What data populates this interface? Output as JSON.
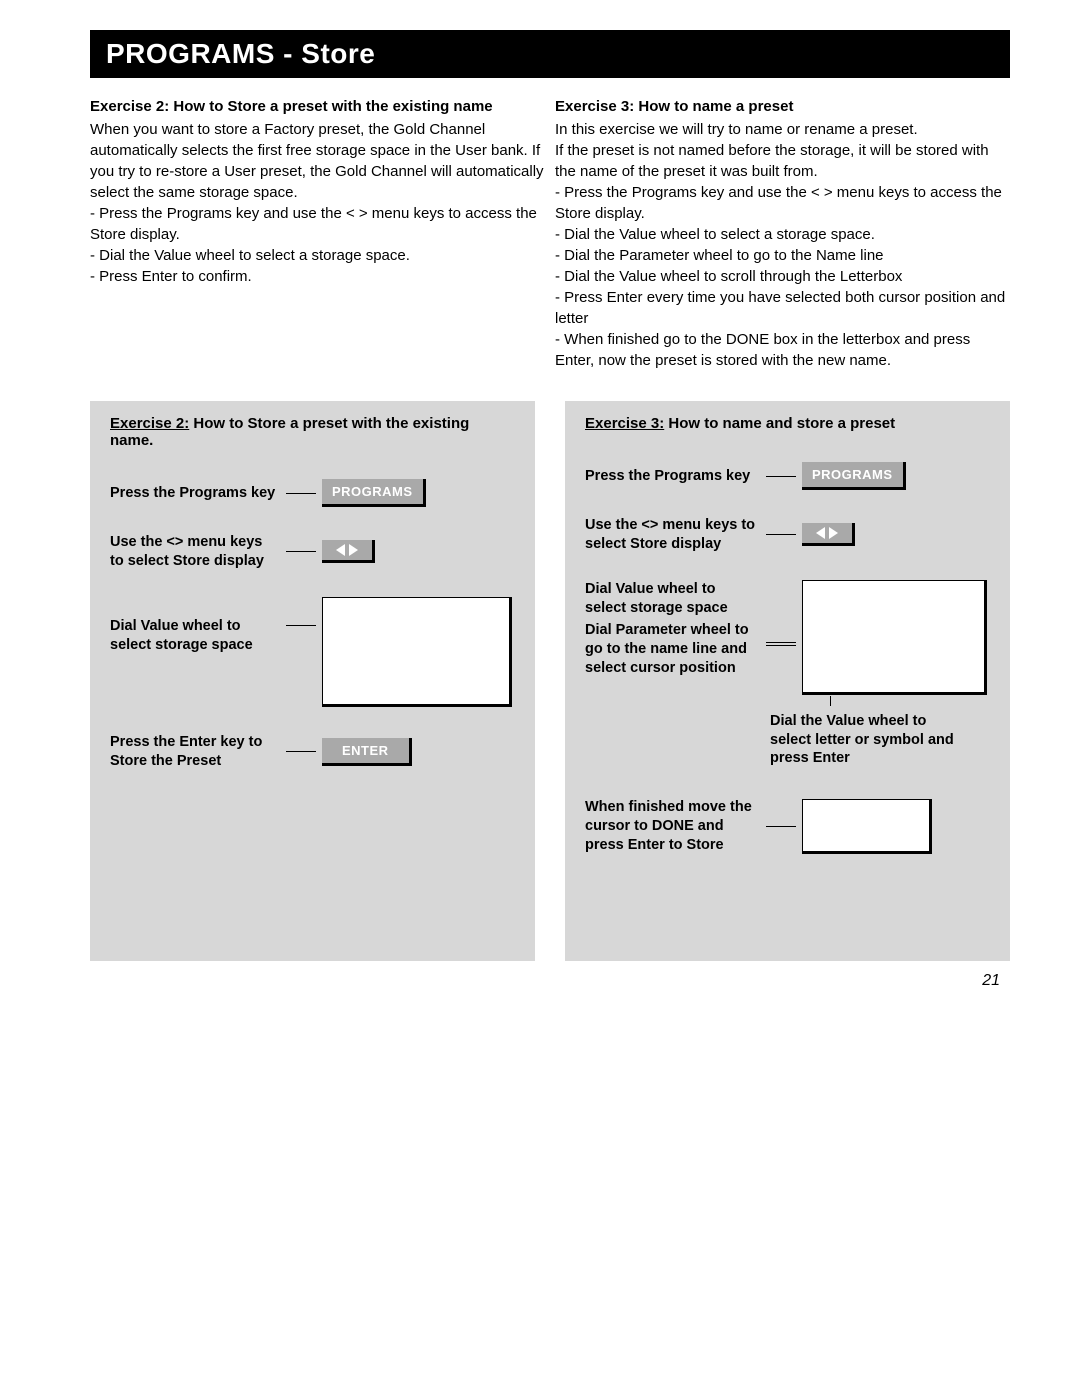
{
  "title_bar": "PROGRAMS - Store",
  "page_number": "21",
  "left_intro": {
    "heading": "Exercise 2: How to Store a preset with the existing name",
    "p1": "When you want to store a Factory preset, the Gold Channel automatically selects the first free storage space in the User bank. If you try to re-store a User preset, the Gold Channel will automatically select the same storage space.",
    "b1": "- Press the Programs key and use the < > menu keys to access the Store display.",
    "b2": "- Dial the Value wheel to select a storage space.",
    "b3": "- Press Enter to confirm."
  },
  "right_intro": {
    "heading": "Exercise 3: How to name a preset",
    "p1": "In this exercise we will try to name or rename a preset.",
    "p2": "If the preset is not named before the storage, it will be stored with the name of the preset it was built from.",
    "b1": "- Press the Programs key and use the < > menu keys to access the Store display.",
    "b2": "- Dial the Value wheel to select a storage space.",
    "b3": "- Dial the Parameter wheel to go to the Name line",
    "b4": "- Dial the Value wheel to scroll through the Letterbox",
    "b5": "- Press Enter every time you have selected both cursor position and letter",
    "b6": "- When finished go to the DONE box in the letterbox and press Enter, now the preset is stored with the new name."
  },
  "diag_left": {
    "title_u": "Exercise 2:",
    "title_rest": " How to Store a preset with the existing name.",
    "s1": "Press the Programs key",
    "s2": "Use the <> menu keys to select Store display",
    "s3": "Dial Value wheel to select storage space",
    "s4": "Press the Enter key to Store the Preset",
    "btn_programs": "PROGRAMS",
    "btn_enter": "ENTER"
  },
  "diag_right": {
    "title_u": "Exercise 3:",
    "title_rest": " How to name and store a preset",
    "s1": "Press the Programs key",
    "s2": "Use the <> menu keys to select Store display",
    "s3a": "Dial Value wheel to select storage space",
    "s3b": "Dial Parameter wheel to go to the name line and select cursor position",
    "s3c": "Dial the Value wheel to select letter or symbol and press Enter",
    "s4": "When finished move the cursor to DONE and press Enter to Store",
    "btn_programs": "PROGRAMS"
  }
}
